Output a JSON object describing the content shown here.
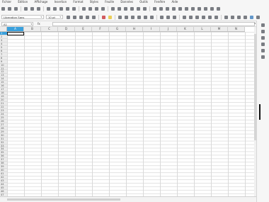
{
  "menu": [
    "Fichier",
    "Édition",
    "Affichage",
    "Insertion",
    "Format",
    "Styles",
    "Feuille",
    "Données",
    "Outils",
    "Fenêtre",
    "Aide"
  ],
  "font": {
    "name": "Liberation Sans",
    "size": "10 pt"
  },
  "cell_ref": "A1",
  "formula_symbol": "fx",
  "columns": [
    "A",
    "B",
    "C",
    "D",
    "E",
    "F",
    "G",
    "H",
    "I",
    "J",
    "K",
    "L",
    "M",
    "N"
  ],
  "rows": [
    "1",
    "2",
    "3",
    "4",
    "5",
    "6",
    "7",
    "8",
    "9",
    "10",
    "11",
    "12",
    "13",
    "14",
    "15",
    "16",
    "17",
    "18",
    "19",
    "20",
    "21",
    "22",
    "23",
    "24",
    "25",
    "26",
    "27",
    "28",
    "29",
    "30",
    "31",
    "32",
    "33",
    "34",
    "35",
    "36",
    "37",
    "38",
    "39",
    "40",
    "41",
    "42",
    "43",
    "44",
    "45",
    "46",
    "47",
    "48"
  ],
  "colors": {
    "selection": "#3aa0dc",
    "font_color": "#c8343a",
    "highlight": "#e7c431"
  }
}
